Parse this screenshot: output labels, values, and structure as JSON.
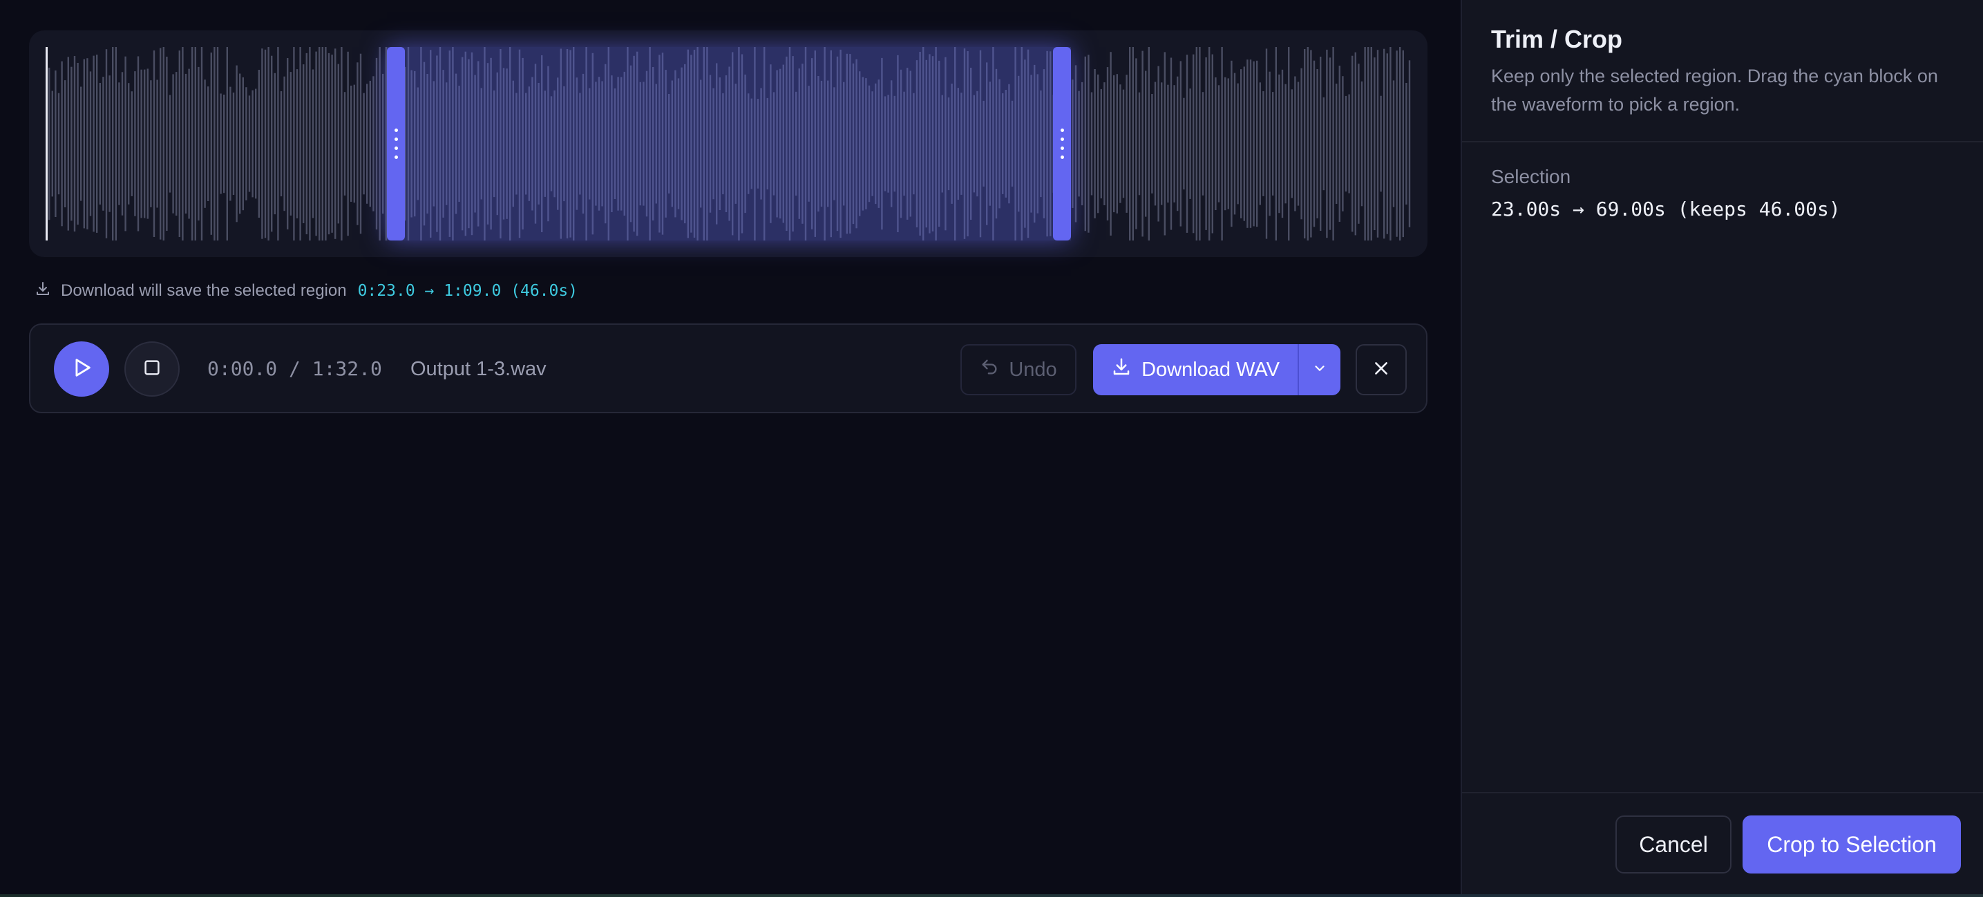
{
  "editor": {
    "waveform": {
      "playhead_seconds": 0,
      "duration_seconds": 92,
      "selection_start_seconds": 23,
      "selection_end_seconds": 69
    },
    "download_hint": {
      "text": "Download will save the selected region",
      "range": "0:23.0 → 1:09.0 (46.0s)"
    },
    "transport": {
      "time": "0:00.0 / 1:32.0",
      "filename": "Output 1-3.wav",
      "undo_label": "Undo",
      "download_label": "Download WAV"
    },
    "colors": {
      "accent": "#6366f1",
      "hint_mono": "#3ec9df",
      "background": "#0b0c17",
      "panel": "#131520"
    },
    "icons": [
      "play-icon",
      "stop-icon",
      "undo-icon",
      "download-icon",
      "chevron-down-icon",
      "close-icon"
    ]
  },
  "panel": {
    "title": "Trim / Crop",
    "description": "Keep only the selected region. Drag the cyan block on the waveform to pick a region.",
    "selection_label": "Selection",
    "selection_value": "23.00s → 69.00s (keeps 46.00s)",
    "cancel_label": "Cancel",
    "crop_label": "Crop to Selection"
  }
}
